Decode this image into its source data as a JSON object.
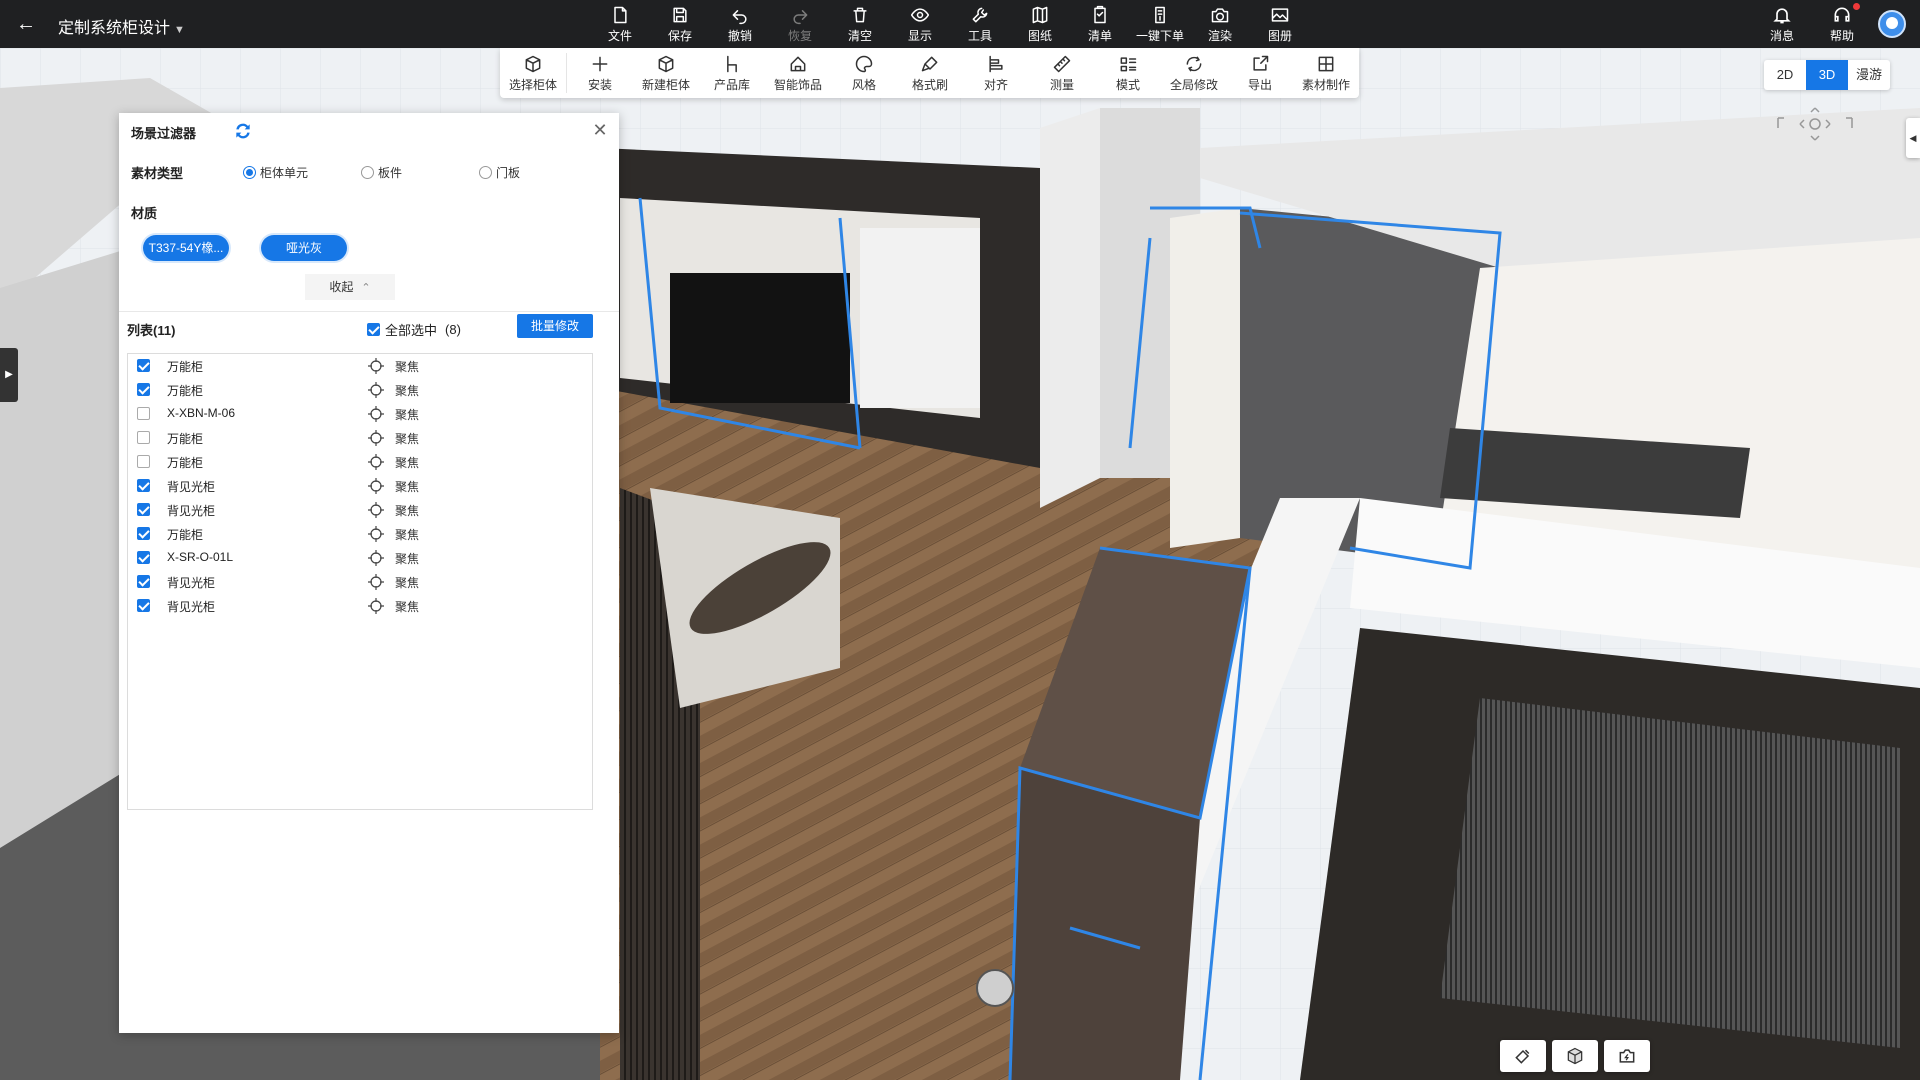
{
  "app": {
    "title": "定制系统柜设计"
  },
  "topbar": {
    "items": [
      {
        "label": "文件",
        "icon": "file-icon",
        "disabled": false
      },
      {
        "label": "保存",
        "icon": "save-icon",
        "disabled": false
      },
      {
        "label": "撤销",
        "icon": "undo-icon",
        "disabled": false
      },
      {
        "label": "恢复",
        "icon": "redo-icon",
        "disabled": true
      },
      {
        "label": "清空",
        "icon": "trash-icon",
        "disabled": false
      },
      {
        "label": "显示",
        "icon": "eye-icon",
        "disabled": false
      },
      {
        "label": "工具",
        "icon": "wrench-icon",
        "disabled": false
      },
      {
        "label": "图纸",
        "icon": "drawing-icon",
        "disabled": false
      },
      {
        "label": "清单",
        "icon": "checklist-icon",
        "disabled": false
      },
      {
        "label": "一键下单",
        "icon": "order-icon",
        "disabled": false
      },
      {
        "label": "渲染",
        "icon": "camera-icon",
        "disabled": false
      },
      {
        "label": "图册",
        "icon": "album-icon",
        "disabled": false
      }
    ],
    "right": [
      {
        "label": "消息",
        "icon": "bell-icon"
      },
      {
        "label": "帮助",
        "icon": "headset-icon"
      }
    ]
  },
  "subbar": {
    "items": [
      {
        "label": "选择柜体",
        "icon": "select-cabinet-icon"
      },
      {
        "label": "安装",
        "icon": "plus-icon"
      },
      {
        "label": "新建柜体",
        "icon": "cube-icon"
      },
      {
        "label": "产品库",
        "icon": "chair-icon"
      },
      {
        "label": "智能饰品",
        "icon": "decor-icon"
      },
      {
        "label": "风格",
        "icon": "palette-icon"
      },
      {
        "label": "格式刷",
        "icon": "brush-icon"
      },
      {
        "label": "对齐",
        "icon": "align-icon"
      },
      {
        "label": "测量",
        "icon": "ruler-icon"
      },
      {
        "label": "模式",
        "icon": "mode-icon"
      },
      {
        "label": "全局修改",
        "icon": "global-edit-icon"
      },
      {
        "label": "导出",
        "icon": "export-icon"
      },
      {
        "label": "素材制作",
        "icon": "material-make-icon"
      }
    ]
  },
  "view_toggle": {
    "options": [
      "2D",
      "3D",
      "漫游"
    ],
    "active": "3D"
  },
  "panel": {
    "title": "场景过滤器",
    "type_label": "素材类型",
    "types": [
      {
        "label": "柜体单元",
        "checked": true
      },
      {
        "label": "板件",
        "checked": false
      },
      {
        "label": "门板",
        "checked": false
      }
    ],
    "material_label": "材质",
    "materials": [
      "T337-54Y橡...",
      "哑光灰"
    ],
    "collapse_label": "收起",
    "list_title": "列表(11)",
    "select_all_label": "全部选中",
    "select_all_checked": true,
    "selected_count": "(8)",
    "batch_button": "批量修改",
    "focus_label": "聚焦",
    "items": [
      {
        "name": "万能柜",
        "checked": true
      },
      {
        "name": "万能柜",
        "checked": true
      },
      {
        "name": "X-XBN-M-06",
        "checked": false
      },
      {
        "name": "万能柜",
        "checked": false
      },
      {
        "name": "万能柜",
        "checked": false
      },
      {
        "name": "背见光柜",
        "checked": true
      },
      {
        "name": "背见光柜",
        "checked": true
      },
      {
        "name": "万能柜",
        "checked": true
      },
      {
        "name": "X-SR-O-01L",
        "checked": true
      },
      {
        "name": "背见光柜",
        "checked": true
      },
      {
        "name": "背见光柜",
        "checked": true
      }
    ]
  },
  "colors": {
    "accent": "#1677e6",
    "topbar": "#1f2022",
    "floor": "#8a6a4c",
    "selection": "#2f86e6"
  }
}
